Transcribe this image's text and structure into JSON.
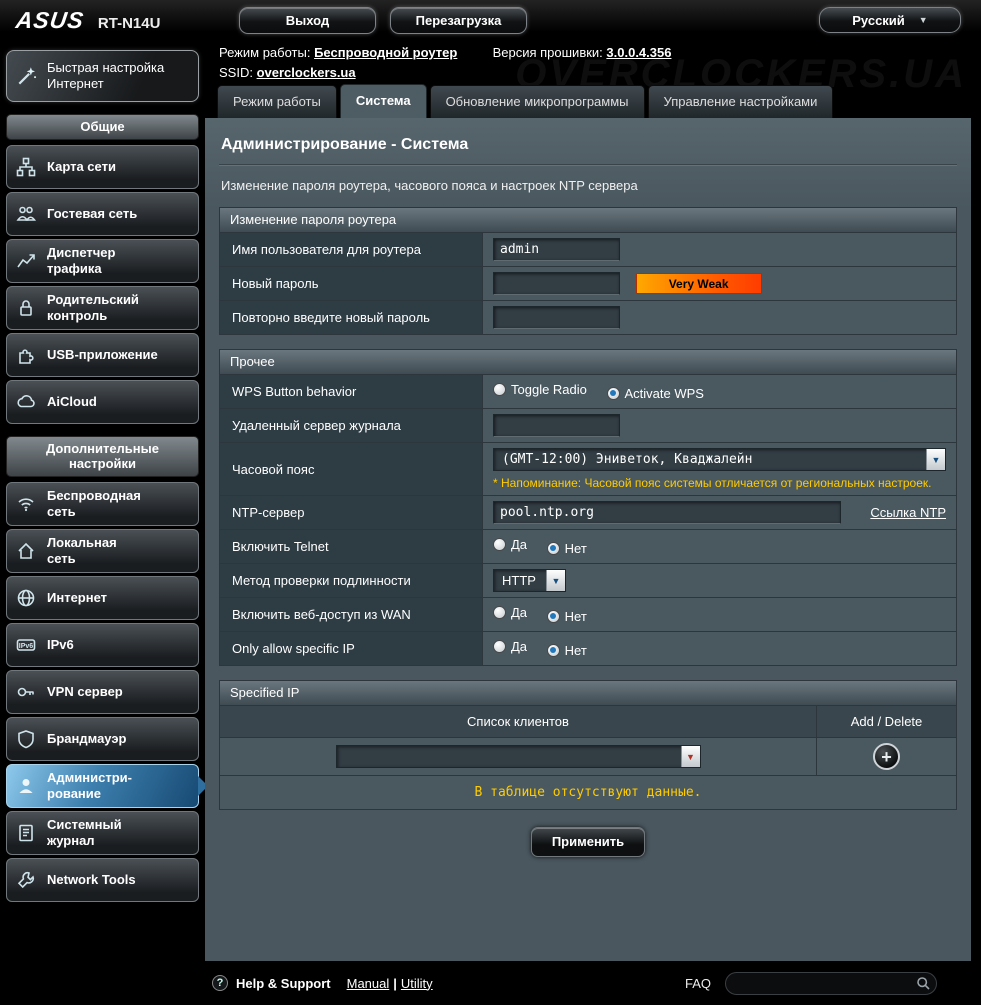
{
  "icons": {
    "dropdown_arrow": "▼",
    "language_chevron": "▼",
    "add_symbol": "+",
    "help_symbol": "?"
  },
  "watermark": "OVERCLOCKERS.UA",
  "topbar": {
    "brand": "ASUS",
    "model": "RT-N14U",
    "logout": "Выход",
    "reboot": "Перезагрузка",
    "language": "Русский"
  },
  "info": {
    "mode_label": "Режим работы:",
    "mode_value": "Беспроводной роутер",
    "fw_label": "Версия прошивки:",
    "fw_value": "3.0.0.4.356",
    "ssid_label": "SSID:",
    "ssid_value": "overclockers.ua"
  },
  "tabs": [
    "Режим работы",
    "Система",
    "Обновление микропрограммы",
    "Управление настройками"
  ],
  "sidebar": {
    "quick_setup": "Быстрая настройка\nИнтернет",
    "general_header": "Общие",
    "general_items": [
      "Карта сети",
      "Гостевая сеть",
      "Диспетчер\nтрафика",
      "Родительский\nконтроль",
      "USB-приложение",
      "AiCloud"
    ],
    "advanced_header": "Дополнительные\nнастройки",
    "advanced_items": [
      "Беспроводная\nсеть",
      "Локальная\nсеть",
      "Интернет",
      "IPv6",
      "VPN сервер",
      "Брандмауэр",
      "Администри-\nрование",
      "Системный\nжурнал",
      "Network Tools"
    ]
  },
  "main": {
    "title": "Администрирование - Система",
    "description": "Изменение пароля роутера, часового пояса и настроек NTP сервера",
    "password_section": {
      "header": "Изменение пароля роутера",
      "username_label": "Имя пользователя для роутера",
      "username_value": "admin",
      "new_password_label": "Новый пароль",
      "strength": "Very Weak",
      "retype_label": "Повторно введите новый пароль"
    },
    "misc_section": {
      "header": "Прочее",
      "wps_label": "WPS Button behavior",
      "wps_option_toggle": "Toggle Radio",
      "wps_option_activate": "Activate WPS",
      "remote_log_label": "Удаленный сервер журнала",
      "timezone_label": "Часовой пояс",
      "timezone_value": "(GMT-12:00) Эниветок, Кваджалейн",
      "timezone_note": "* Напоминание: Часовой пояс системы отличается от региональных настроек.",
      "ntp_label": "NTP-сервер",
      "ntp_value": "pool.ntp.org",
      "ntp_link": "Ссылка NTP",
      "telnet_label": "Включить Telnet",
      "yes": "Да",
      "no": "Нет",
      "auth_label": "Метод проверки подлинности",
      "auth_value": "HTTP",
      "wan_label": "Включить веб-доступ из WAN",
      "specific_ip_label": "Only allow specific IP"
    },
    "specified_ip": {
      "header": "Specified IP",
      "col_clients": "Список клиентов",
      "col_add": "Add / Delete",
      "empty_text": "В таблице отсутствуют данные."
    },
    "apply": "Применить"
  },
  "footer": {
    "help": "Help & Support",
    "manual": "Manual",
    "sep": "|",
    "utility": "Utility",
    "faq": "FAQ"
  }
}
